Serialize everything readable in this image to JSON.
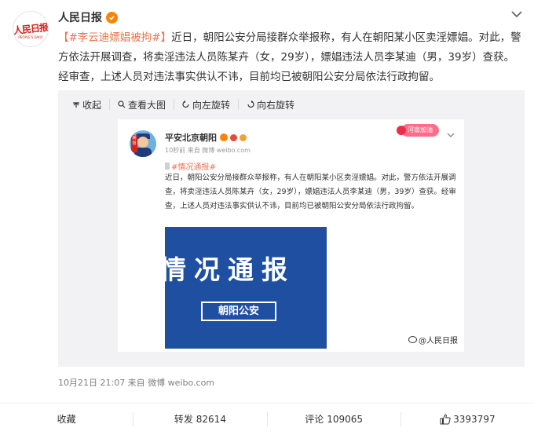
{
  "author": {
    "name": "人民日报",
    "logo_text": "人民日报",
    "logo_sub": "PEOPLE'S DAILY"
  },
  "post": {
    "topic": "【#李云迪嫖娼被拘#】",
    "text": "近日，朝阳公安分局接群众举报称，有人在朝阳某小区卖淫嫖娼。对此，警方依法开展调查，将卖淫违法人员陈某卉（女，29岁），嫖娼违法人员李某迪（男，39岁）查获。经审查，上述人员对违法事实供认不讳，目前均已被朝阳公安分局依法行政拘留。"
  },
  "toolbar": {
    "collapse": "收起",
    "view_large": "查看大图",
    "rotate_left": "向左旋转",
    "rotate_right": "向右旋转"
  },
  "embedded": {
    "author": "平安北京朝阳",
    "avatar_sign": "朝阳",
    "meta": "10秒前  来自 微博 weibo.com",
    "tag": "河南加油",
    "topic": "#情况通报#",
    "text": "近日，朝阳公安分局接群众举报称，有人在朝阳某小区卖淫嫖娼。对此，警方依法开展调查，将卖淫违法人员陈某卉（女，29岁），嫖娼违法人员李某迪（男，39岁）查获。经审查，上述人员对违法事实供认不讳，目前均已被朝阳公安分局依法行政拘留。",
    "banner_title": "情况通报",
    "banner_chip": "朝阳公安",
    "watermark": "@人民日报"
  },
  "timestamp": "10月21日 21:07  来自 微博 weibo.com",
  "actions": {
    "favorite": "收藏",
    "repost_label": "转发",
    "repost_count": "82614",
    "comment_label": "评论",
    "comment_count": "109065",
    "like_count": "3393797"
  },
  "colors": {
    "topic": "#eb7350",
    "verified": "#ff8200",
    "banner": "#1f4fa1",
    "brand_red": "#d8211a"
  }
}
